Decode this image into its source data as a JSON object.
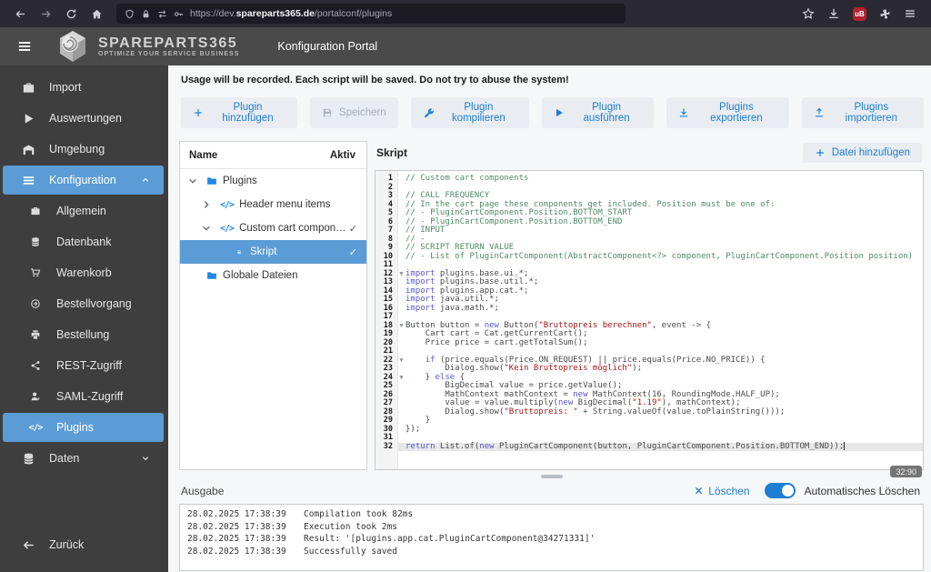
{
  "browser": {
    "url_prefix": "https://dev.",
    "url_domain": "spareparts365.de",
    "url_path": "/portalconf/plugins"
  },
  "header": {
    "logo_title": "SpareParts365",
    "logo_tagline": "Optimize your service business",
    "portal_title": "Konfiguration Portal"
  },
  "sidebar": {
    "items": [
      {
        "id": "import",
        "label": "Import",
        "icon": "briefcase",
        "level": 0
      },
      {
        "id": "auswertungen",
        "label": "Auswertungen",
        "icon": "play",
        "level": 0
      },
      {
        "id": "umgebung",
        "label": "Umgebung",
        "icon": "warehouse",
        "level": 0
      },
      {
        "id": "konfiguration",
        "label": "Konfiguration",
        "icon": "list",
        "level": 0,
        "selected": true,
        "chevron": "up"
      },
      {
        "id": "allgemein",
        "label": "Allgemein",
        "icon": "briefcase",
        "level": 1
      },
      {
        "id": "datenbank",
        "label": "Datenbank",
        "icon": "database",
        "level": 1
      },
      {
        "id": "warenkorb",
        "label": "Warenkorb",
        "icon": "cart",
        "level": 1
      },
      {
        "id": "bestellvorgang",
        "label": "Bestellvorgang",
        "icon": "arrow-circle",
        "level": 1
      },
      {
        "id": "bestellung",
        "label": "Bestellung",
        "icon": "printer",
        "level": 1
      },
      {
        "id": "rest-zugriff",
        "label": "REST-Zugriff",
        "icon": "share",
        "level": 1
      },
      {
        "id": "saml-zugriff",
        "label": "SAML-Zugriff",
        "icon": "user-key",
        "level": 1
      },
      {
        "id": "plugins",
        "label": "Plugins",
        "icon": "code",
        "level": 1,
        "selected": true
      },
      {
        "id": "daten",
        "label": "Daten",
        "icon": "database",
        "level": 0,
        "chevron": "down"
      }
    ],
    "back_label": "Zurück"
  },
  "main": {
    "warning": "Usage will be recorded. Each script will be saved. Do not try to abuse the system!",
    "toolbar": {
      "buttons": [
        {
          "id": "plugin-hinzufuegen",
          "label": "Plugin hinzufügen",
          "icon": "plus"
        },
        {
          "id": "speichern",
          "label": "Speichern",
          "icon": "save",
          "disabled": true
        },
        {
          "id": "plugin-kompilieren",
          "label": "Plugin kompilieren",
          "icon": "wrench"
        },
        {
          "id": "plugin-ausfuehren",
          "label": "Plugin ausführen",
          "icon": "play"
        },
        {
          "id": "plugins-exportieren",
          "label": "Plugins exportieren",
          "icon": "download"
        },
        {
          "id": "plugins-importieren",
          "label": "Plugins importieren",
          "icon": "upload"
        }
      ]
    },
    "tree": {
      "columns": [
        "Name",
        "Aktiv"
      ],
      "rows": [
        {
          "label": "Plugins",
          "icon": "folder",
          "expander": "down",
          "level": 0,
          "active": ""
        },
        {
          "label": "Header menu items",
          "icon": "code",
          "expander": "right",
          "level": 1,
          "active": ""
        },
        {
          "label": "Custom cart compon…",
          "icon": "code",
          "expander": "down",
          "level": 1,
          "active": "✓"
        },
        {
          "label": "Skript",
          "icon": "file",
          "expander": "",
          "level": 2,
          "active": "✓",
          "selected": true
        },
        {
          "label": "Globale Dateien",
          "icon": "folder",
          "expander": "",
          "level": 0,
          "active": ""
        }
      ]
    },
    "editor": {
      "title": "Skript",
      "add_file_label": "Datei hinzufügen",
      "position_badge": "32:90",
      "lines": [
        {
          "n": 1,
          "t": [
            [
              "cm",
              "// Custom cart components"
            ]
          ]
        },
        {
          "n": 2,
          "t": []
        },
        {
          "n": 3,
          "t": [
            [
              "cm",
              "// CALL FREQUENCY"
            ]
          ]
        },
        {
          "n": 4,
          "t": [
            [
              "cm",
              "// In the cart page these components get included. Position must be one of:"
            ]
          ]
        },
        {
          "n": 5,
          "t": [
            [
              "cm",
              "// - PluginCartComponent.Position.BOTTOM_START"
            ]
          ]
        },
        {
          "n": 6,
          "t": [
            [
              "cm",
              "// - PluginCartComponent.Position.BOTTOM_END"
            ]
          ]
        },
        {
          "n": 7,
          "t": [
            [
              "cm",
              "// INPUT"
            ]
          ]
        },
        {
          "n": 8,
          "t": [
            [
              "cm",
              "// -"
            ]
          ]
        },
        {
          "n": 9,
          "t": [
            [
              "cm",
              "// SCRIPT RETURN VALUE"
            ]
          ]
        },
        {
          "n": 10,
          "t": [
            [
              "cm",
              "// - List of PluginCartComponent(AbstractComponent<?> component, PluginCartComponent.Position position)"
            ]
          ]
        },
        {
          "n": 11,
          "t": []
        },
        {
          "n": 12,
          "fold": true,
          "t": [
            [
              "kw",
              "import"
            ],
            [
              "pl",
              " plugins.base.ui.*;"
            ]
          ]
        },
        {
          "n": 13,
          "t": [
            [
              "kw",
              "import"
            ],
            [
              "pl",
              " plugins.base.util.*;"
            ]
          ]
        },
        {
          "n": 14,
          "t": [
            [
              "kw",
              "import"
            ],
            [
              "pl",
              " plugins.app.cat.*;"
            ]
          ]
        },
        {
          "n": 15,
          "t": [
            [
              "kw",
              "import"
            ],
            [
              "pl",
              " java.util.*;"
            ]
          ]
        },
        {
          "n": 16,
          "t": [
            [
              "kw",
              "import"
            ],
            [
              "pl",
              " java.math.*;"
            ]
          ]
        },
        {
          "n": 17,
          "t": []
        },
        {
          "n": 18,
          "fold": true,
          "t": [
            [
              "pl",
              "Button button = "
            ],
            [
              "kw",
              "new"
            ],
            [
              "pl",
              " Button("
            ],
            [
              "str",
              "\"Bruttopreis berechnen\""
            ],
            [
              "pl",
              ", event -> {"
            ]
          ]
        },
        {
          "n": 19,
          "t": [
            [
              "pl",
              "    Cart cart = Cat.getCurrentCart();"
            ]
          ]
        },
        {
          "n": 20,
          "t": [
            [
              "pl",
              "    Price price = cart.getTotalSum();"
            ]
          ]
        },
        {
          "n": 21,
          "t": []
        },
        {
          "n": 22,
          "fold": true,
          "t": [
            [
              "pl",
              "    "
            ],
            [
              "kw",
              "if"
            ],
            [
              "pl",
              " (price.equals(Price.ON_REQUEST) || price.equals(Price.NO_PRICE)) {"
            ]
          ]
        },
        {
          "n": 23,
          "t": [
            [
              "pl",
              "        Dialog.show("
            ],
            [
              "str",
              "\"Kein Bruttopreis möglich\""
            ],
            [
              "pl",
              ");"
            ]
          ]
        },
        {
          "n": 24,
          "fold": true,
          "t": [
            [
              "pl",
              "    } "
            ],
            [
              "kw",
              "else"
            ],
            [
              "pl",
              " {"
            ]
          ]
        },
        {
          "n": 25,
          "t": [
            [
              "pl",
              "        BigDecimal value = price.getValue();"
            ]
          ]
        },
        {
          "n": 26,
          "t": [
            [
              "pl",
              "        MathContext mathContext = "
            ],
            [
              "kw",
              "new"
            ],
            [
              "pl",
              " MathContext(16, RoundingMode.HALF_UP);"
            ]
          ]
        },
        {
          "n": 27,
          "t": [
            [
              "pl",
              "        value = value.multiply("
            ],
            [
              "kw",
              "new"
            ],
            [
              "pl",
              " BigDecimal("
            ],
            [
              "str",
              "\"1.19\""
            ],
            [
              "pl",
              "), mathContext);"
            ]
          ]
        },
        {
          "n": 28,
          "t": [
            [
              "pl",
              "        Dialog.show("
            ],
            [
              "str",
              "\"Bruttopreis: \""
            ],
            [
              "pl",
              " + String.valueOf(value.toPlainString()));"
            ]
          ]
        },
        {
          "n": 29,
          "t": [
            [
              "pl",
              "    }"
            ]
          ]
        },
        {
          "n": 30,
          "t": [
            [
              "pl",
              "});"
            ]
          ]
        },
        {
          "n": 31,
          "t": []
        },
        {
          "n": 32,
          "active": true,
          "t": [
            [
              "kw",
              "return"
            ],
            [
              "pl",
              " List.of("
            ],
            [
              "kw",
              "new"
            ],
            [
              "pl",
              " PluginCartComponent(button, PluginCartComponent.Position.BOTTOM_END));"
            ]
          ]
        }
      ]
    },
    "output": {
      "title": "Ausgabe",
      "clear_label": "Löschen",
      "auto_clear_label": "Automatisches Löschen",
      "log": [
        {
          "time": "28.02.2025 17:38:39",
          "text": "Compilation took 82ms"
        },
        {
          "time": "28.02.2025 17:38:39",
          "text": "Execution took 2ms"
        },
        {
          "time": "28.02.2025 17:38:39",
          "text": "Result: '[plugins.app.cat.PluginCartComponent@34271331]'"
        },
        {
          "time": "28.02.2025 17:38:39",
          "text": "Successfully saved"
        }
      ]
    }
  },
  "colors": {
    "accent_blue": "#5b9cd6",
    "link_blue": "#1d7ed3",
    "sidebar_bg": "#3e3e3e",
    "header_bg": "#4a4a4a",
    "comment_green": "#4f8a65",
    "keyword_purple": "#5a55d0",
    "string_red": "#a31515"
  }
}
